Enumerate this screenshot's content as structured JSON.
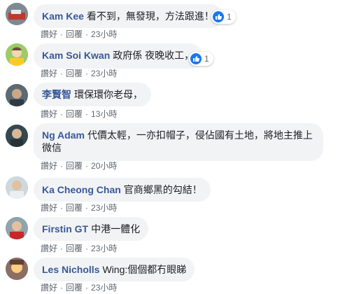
{
  "comments": [
    {
      "author": "Kam Kee",
      "text": "看不到，無發現，方法跟進！",
      "reactions": "1",
      "like": "讚好",
      "reply": "回覆",
      "time": "23小時"
    },
    {
      "author": "Kam Soi Kwan",
      "text": "政府係 夜晚收工，",
      "reactions": "1",
      "like": "讚好",
      "reply": "回覆",
      "time": "23小時"
    },
    {
      "author": "李賢智",
      "text": "環保環你老母，",
      "like": "讚好",
      "reply": "回覆",
      "time": "13小時"
    },
    {
      "author": "Ng Adam",
      "text_line1": "代價太輕，一亦扣帽子，侵佔國有土地，將地主推上",
      "text_line2": "微信",
      "like": "讚好",
      "reply": "回覆",
      "time": "20小時"
    },
    {
      "author": "Ka Cheong Chan",
      "text": "官商鄉黑的勾結！",
      "like": "讚好",
      "reply": "回覆",
      "time": "23小時"
    },
    {
      "author": "Firstin GT",
      "text": "中港一體化",
      "like": "讚好",
      "reply": "回覆",
      "time": "23小時"
    },
    {
      "author": "Les Nicholls",
      "text": "Wing:個個都冇眼睇",
      "like": "讚好",
      "reply": "回覆",
      "time": "23小時"
    }
  ],
  "separator": "·"
}
